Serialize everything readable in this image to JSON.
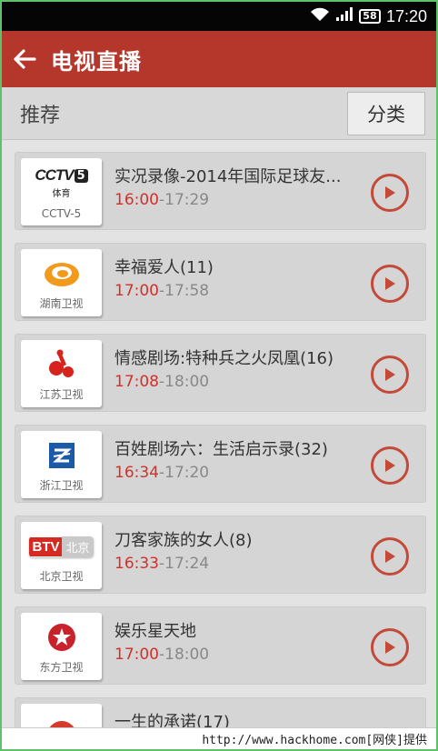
{
  "status_bar": {
    "battery": "58",
    "time": "17:20"
  },
  "app_bar": {
    "back_icon": "arrow-left-icon",
    "title": "电视直播"
  },
  "recommend_bar": {
    "title": "推荐",
    "category_button": "分类"
  },
  "channels": [
    {
      "logo": "cctv5-logo",
      "caption": "CCTV-5",
      "program": "实况录像-2014年国际足球友...",
      "start": "16:00",
      "end": "-17:29"
    },
    {
      "logo": "hunan-tv-logo",
      "caption": "湖南卫视",
      "program": "幸福爱人(11)",
      "start": "17:00",
      "end": "-17:58"
    },
    {
      "logo": "jiangsu-tv-logo",
      "caption": "江苏卫视",
      "program": "情感剧场:特种兵之火凤凰(16)",
      "start": "17:08",
      "end": "-18:00"
    },
    {
      "logo": "zhejiang-tv-logo",
      "caption": "浙江卫视",
      "program": "百姓剧场六：生活启示录(32)",
      "start": "16:34",
      "end": "-17:20"
    },
    {
      "logo": "beijing-tv-logo",
      "caption": "北京卫视",
      "program": "刀客家族的女人(8)",
      "start": "16:33",
      "end": "-17:24"
    },
    {
      "logo": "dragon-tv-logo",
      "caption": "东方卫视",
      "program": "娱乐星天地",
      "start": "17:00",
      "end": "-18:00"
    },
    {
      "logo": "partial-channel-logo",
      "caption": "",
      "program": "一生的承诺(17)",
      "start": "",
      "end": ""
    }
  ],
  "logo_text": {
    "cctv_main": "CCTV",
    "cctv_number": "5",
    "cctv_sub": "体育",
    "btv_main": "BTV",
    "btv_sub": "北京"
  },
  "footer": {
    "watermark": "http://www.hackhome.com[网侠]提供"
  },
  "colors": {
    "accent": "#b5362a",
    "start_time": "#d0312a",
    "play_ring": "#c34a38"
  }
}
